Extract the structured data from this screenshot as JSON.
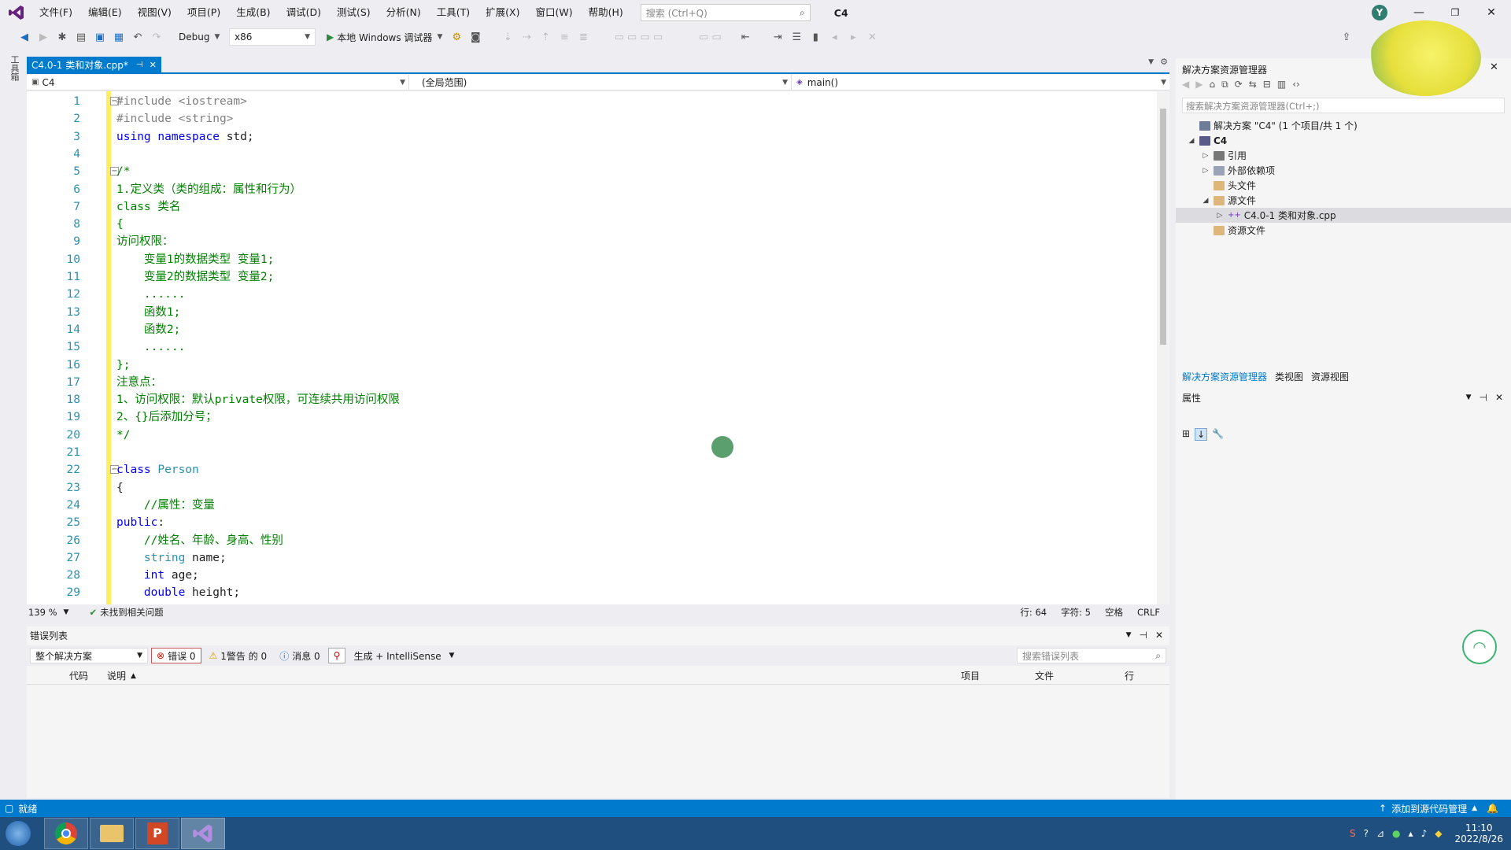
{
  "menubar": {
    "items": [
      "文件(F)",
      "编辑(E)",
      "视图(V)",
      "项目(P)",
      "生成(B)",
      "调试(D)",
      "测试(S)",
      "分析(N)",
      "工具(T)",
      "扩展(X)",
      "窗口(W)",
      "帮助(H)"
    ],
    "search_placeholder": "搜索 (Ctrl+Q)",
    "app_name": "C4",
    "avatar_letter": "Y"
  },
  "toolbar": {
    "config": "Debug",
    "platform": "x86",
    "run_label": "本地 Windows 调试器"
  },
  "side_label": "工具箱",
  "tab": {
    "title": "C4.0-1 类和对象.cpp*"
  },
  "navbar": {
    "project": "C4",
    "scope": "(全局范围)",
    "member": "main()"
  },
  "code": {
    "line_numbers": [
      "1",
      "2",
      "3",
      "4",
      "5",
      "6",
      "7",
      "8",
      "9",
      "10",
      "11",
      "12",
      "13",
      "14",
      "15",
      "16",
      "17",
      "18",
      "19",
      "20",
      "21",
      "22",
      "23",
      "24",
      "25",
      "26",
      "27",
      "28",
      "29"
    ],
    "l1_pp": "#include ",
    "l1_arg": "<iostream>",
    "l2_pp": "#include ",
    "l2_arg": "<string>",
    "l3_kw1": "using",
    "l3_kw2": "namespace",
    "l3_rest": " std;",
    "l5": "/*",
    "l6": "1.定义类（类的组成：属性和行为）",
    "l7": "class 类名",
    "l8": "{",
    "l9": "访问权限：",
    "l10": "    变量1的数据类型 变量1;",
    "l11": "    变量2的数据类型 变量2;",
    "l12": "    ......",
    "l13": "    函数1;",
    "l14": "    函数2;",
    "l15": "    ......",
    "l16": "};",
    "l17": "注意点：",
    "l18": "1、访问权限：默认private权限，可连续共用访问权限",
    "l19": "2、{}后添加分号；",
    "l20": "*/",
    "l22_kw": "class",
    "l22_name": "Person",
    "l23": "{",
    "l24": "    //属性：变量",
    "l25_kw": "public",
    "l25_rest": ":",
    "l26": "    //姓名、年龄、身高、性别",
    "l27_ty": "string",
    "l27_rest": " name;",
    "l28_kw": "int",
    "l28_rest": " age;",
    "l29_kw": "double",
    "l29_rest": " height;"
  },
  "editor_status": {
    "zoom": "139 %",
    "issues": "未找到相关问题",
    "line": "行: 64",
    "char": "字符: 5",
    "mode": "空格",
    "eol": "CRLF"
  },
  "error_list": {
    "title": "错误列表",
    "scope": "整个解决方案",
    "errors": "错误 0",
    "warnings": "1警告 的 0",
    "messages": "消息 0",
    "build_filter": "生成 + IntelliSense",
    "search_placeholder": "搜索错误列表",
    "col_code": "代码",
    "col_desc": "说明",
    "col_project": "项目",
    "col_file": "文件",
    "col_line": "行"
  },
  "solution_explorer": {
    "title": "解决方案资源管理器",
    "search_placeholder": "搜索解决方案资源管理器(Ctrl+;)",
    "solution": "解决方案 \"C4\" (1 个项目/共 1 个)",
    "project": "C4",
    "refs": "引用",
    "ext_deps": "外部依赖项",
    "headers": "头文件",
    "sources": "源文件",
    "source_file": "C4.0-1 类和对象.cpp",
    "resources": "资源文件",
    "tabs": [
      "解决方案资源管理器",
      "类视图",
      "资源视图"
    ]
  },
  "properties": {
    "title": "属性"
  },
  "statusbar": {
    "ready": "就绪",
    "source_control": "添加到源代码管理"
  },
  "taskbar": {
    "time": "11:10",
    "date": "2022/8/26"
  }
}
